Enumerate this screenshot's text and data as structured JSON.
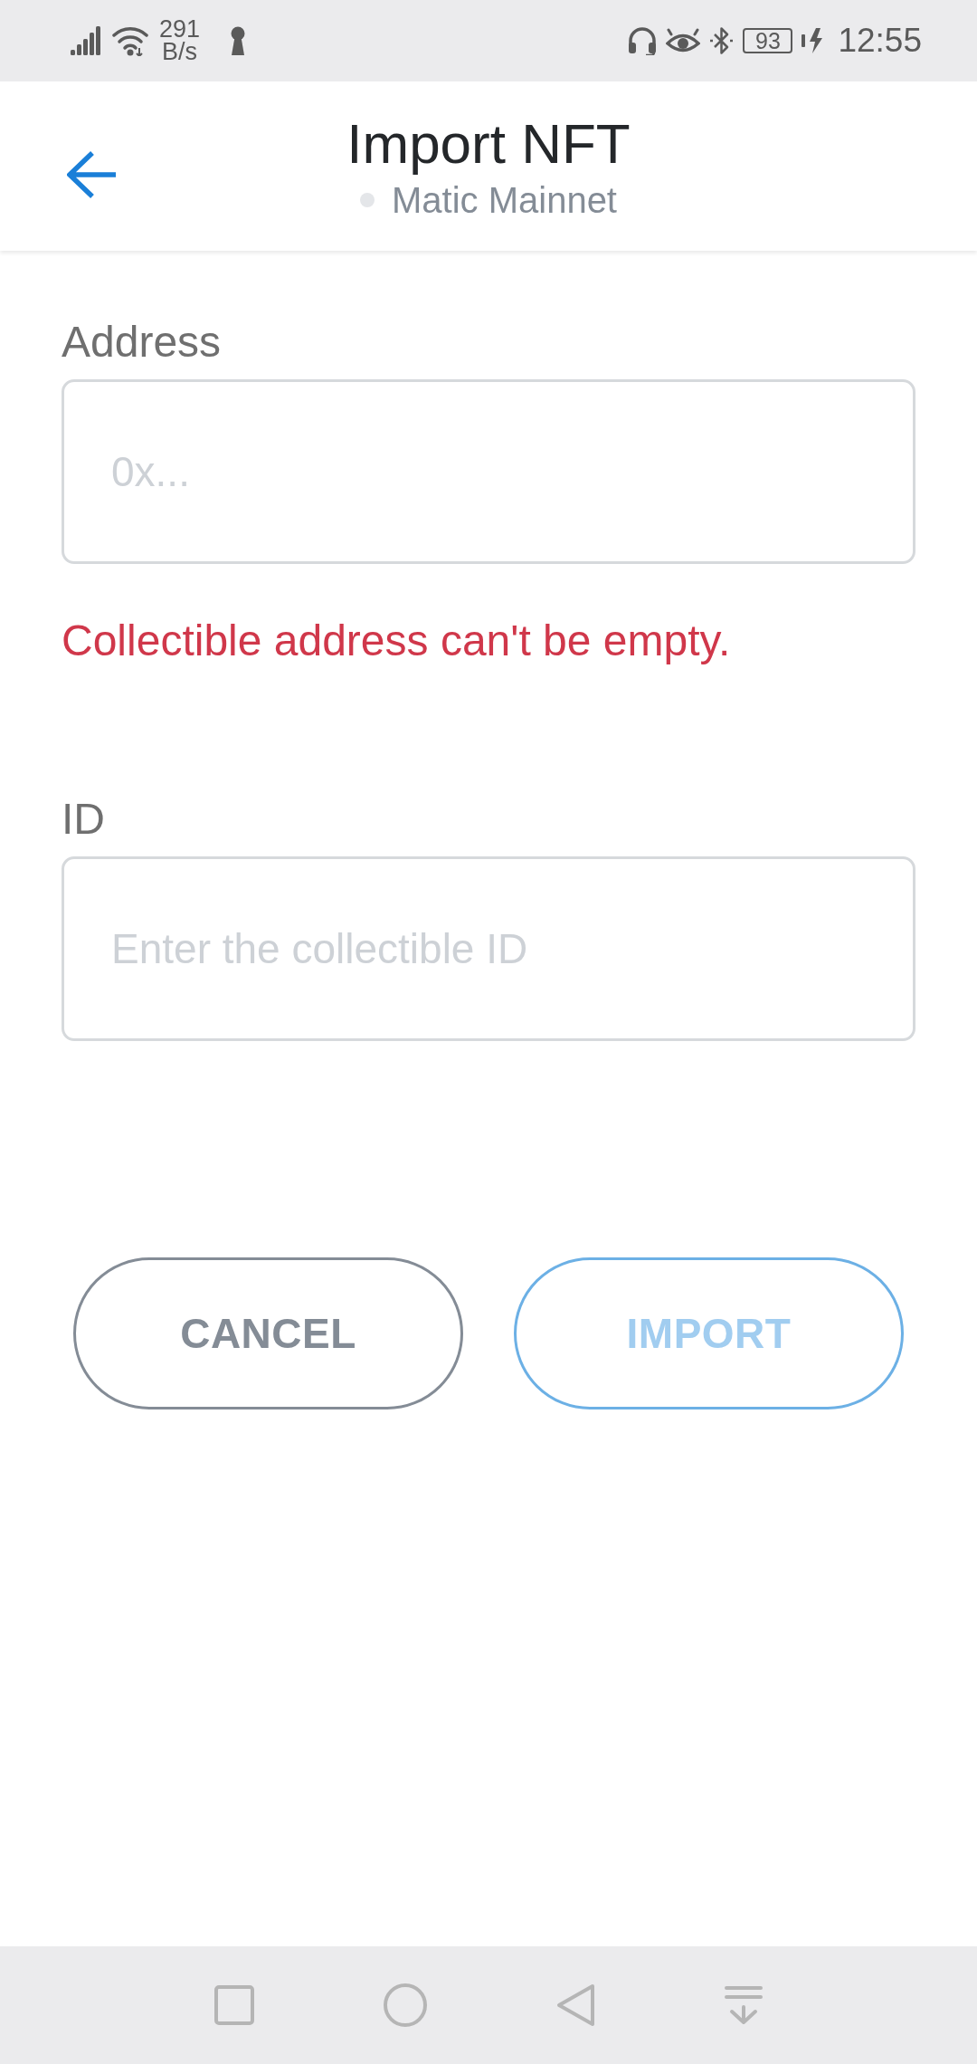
{
  "status_bar": {
    "network_speed": "291",
    "network_speed_unit": "B/s",
    "battery": "93",
    "time": "12:55"
  },
  "header": {
    "title": "Import NFT",
    "network": "Matic Mainnet"
  },
  "fields": [
    {
      "label": "Address",
      "placeholder": "0x...",
      "error": "Collectible address can't be empty."
    },
    {
      "label": "ID",
      "placeholder": "Enter the collectible ID"
    }
  ],
  "buttons": [
    {
      "label": "CANCEL",
      "kind": "secondary",
      "disabled": false
    },
    {
      "label": "IMPORT",
      "kind": "primary",
      "disabled": true
    }
  ]
}
